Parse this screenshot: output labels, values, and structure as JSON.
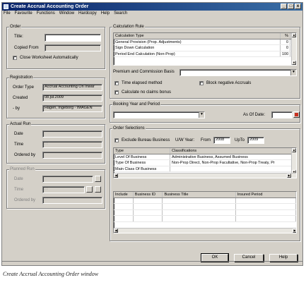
{
  "window": {
    "title": "Create Accrual Accounting Order",
    "min": "_",
    "max": "□",
    "close": "x"
  },
  "menu": [
    "File",
    "Favourite",
    "Functions",
    "Window",
    "Hardcopy",
    "Help",
    "Search"
  ],
  "order": {
    "title": "Order",
    "title_label": "Title:",
    "title_value": "",
    "copied_from_label": "Copied From",
    "copied_from_value": "",
    "close_ws_label": "Close Worksheet Automatically"
  },
  "registration": {
    "title": "Registration",
    "order_type_label": "Order Type",
    "order_type_value": "Accrual Accounting On Inwar",
    "created_label": "Created",
    "created_value": "08.jul.2009",
    "by_label": "- by",
    "by_value": "Hagen, Ingeborg - IMAGEN"
  },
  "actual_run": {
    "title": "Actual Run",
    "date_label": "Date",
    "time_label": "Time",
    "time_value": ": :",
    "ordered_by_label": "Ordered by"
  },
  "planned_run": {
    "title": "Planned Run",
    "date_label": "Date",
    "time_label": "Time",
    "time_value": ": :",
    "ordered_by_label": "Ordered by"
  },
  "calc_rule": {
    "title": "Calculation Rule",
    "headers": [
      "Calculation Type",
      "%"
    ],
    "rows": [
      {
        "type": "General Provision (Prop. Adjustments)",
        "pct": "0"
      },
      {
        "type": "Sign Down Calculation",
        "pct": "0"
      },
      {
        "type": "Period End Calculation (Non-Prop)",
        "pct": "100"
      }
    ],
    "premium_label": "Premium and Commission Basis",
    "time_elapsed_label": "Time elapsed method",
    "block_neg_label": "Block negative Accruals",
    "no_claims_label": "Calculate no claims bonus"
  },
  "booking": {
    "title": "Booking Year and Period",
    "as_of_label": "As Of Date:"
  },
  "order_sel": {
    "title": "Order Selections",
    "exclude_label": "Exclude Bureau Business",
    "uw_label": "U/W Year:",
    "from_label": "From",
    "from_value": "2008",
    "upto_label": "UpTo",
    "upto_value": "2009",
    "class_headers": [
      "Type",
      "Classifications"
    ],
    "class_rows": [
      {
        "type": "Level Of Business",
        "cls": "Administrative Business, Assumed Business"
      },
      {
        "type": "Type Of Business",
        "cls": "Non-Prop Direct, Non-Prop Facultative, Non-Prop Treaty, Pr"
      },
      {
        "type": "Main Class Of Business",
        "cls": ""
      }
    ],
    "biz_headers": [
      "Include",
      "Business ID",
      "Business Title",
      "Insured Period"
    ]
  },
  "buttons": {
    "ok": "OK",
    "cancel": "Cancel",
    "help": "Help"
  },
  "caption": "Create Accrual Accounting Order window"
}
